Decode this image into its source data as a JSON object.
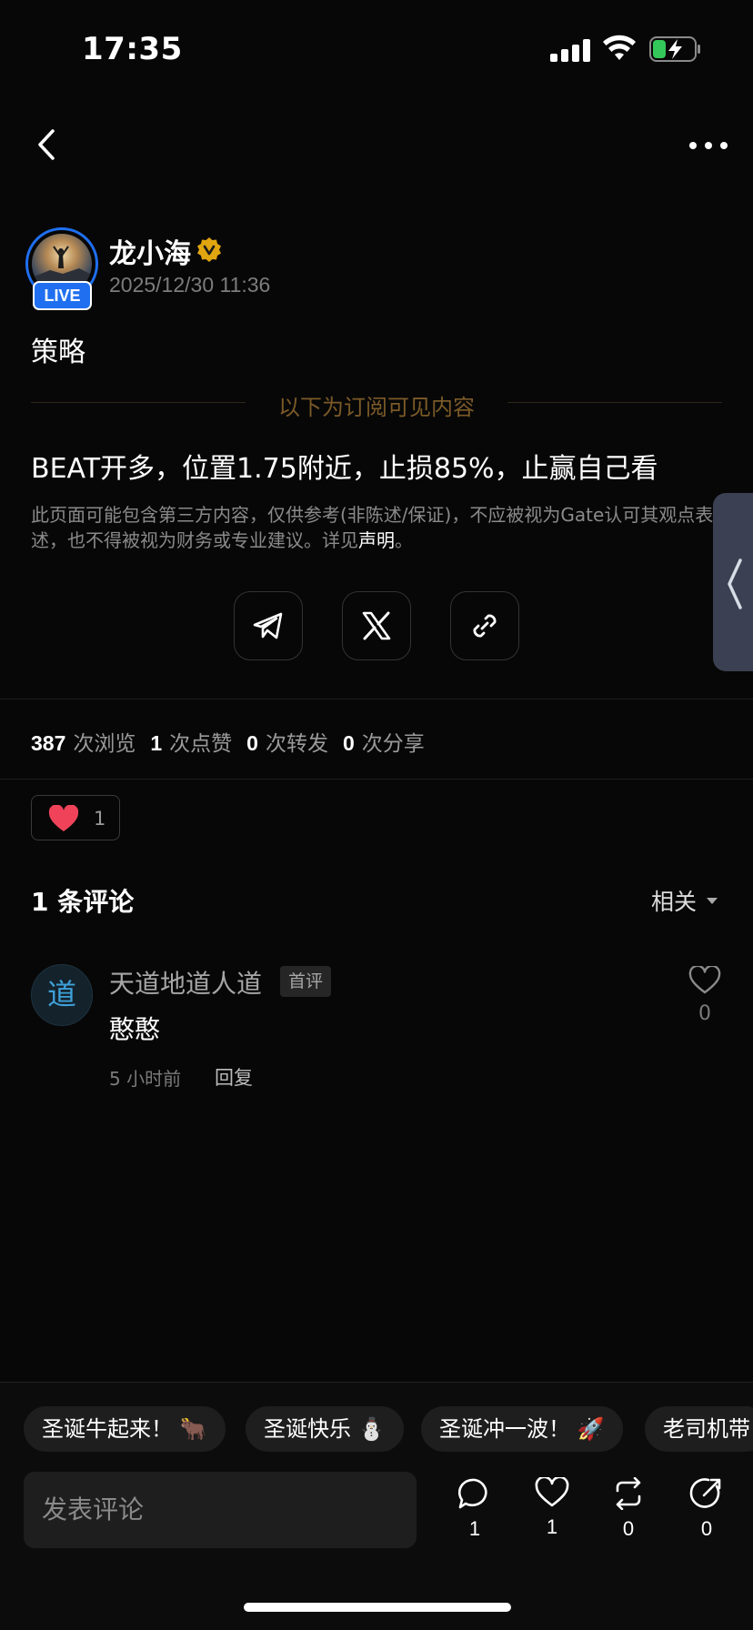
{
  "status_bar": {
    "time": "17:35"
  },
  "author": {
    "name": "龙小海",
    "live_badge": "LIVE",
    "post_time": "2025/12/30 11:36"
  },
  "post": {
    "title": "策略",
    "subscribe_label": "以下为订阅可见内容",
    "body": "BEAT开多，位置1.75附近，止损85%，止赢自己看",
    "disclaimer": "此页面可能包含第三方内容，仅供参考(非陈述/保证)，不应被视为Gate认可其观点表述，也不得被视为财务或专业建议。详见",
    "disclaimer_link": "声明",
    "disclaimer_end": "。"
  },
  "stats": {
    "views": "387",
    "views_label": "次浏览",
    "likes": "1",
    "likes_label": "次点赞",
    "reposts": "0",
    "reposts_label": "次转发",
    "shares": "0",
    "shares_label": "次分享"
  },
  "reaction": {
    "count": "1"
  },
  "comments": {
    "title": "1 条评论",
    "sort": "相关",
    "items": [
      {
        "avatar_char": "道",
        "name": "天道地道人道",
        "badge": "首评",
        "text": "憨憨",
        "time": "5 小时前",
        "reply": "回复",
        "likes": "0"
      }
    ]
  },
  "chips": [
    "圣诞牛起来！ 🐂",
    "圣诞快乐 ⛄",
    "圣诞冲一波！ 🚀",
    "老司机带"
  ],
  "bottom": {
    "input_placeholder": "发表评论",
    "comment_count": "1",
    "like_count": "1",
    "repost_count": "0",
    "share_count": "0"
  },
  "colors": {
    "accent_blue": "#1f6ff0",
    "gold": "#e0a50f",
    "like_red": "#f0435a"
  }
}
